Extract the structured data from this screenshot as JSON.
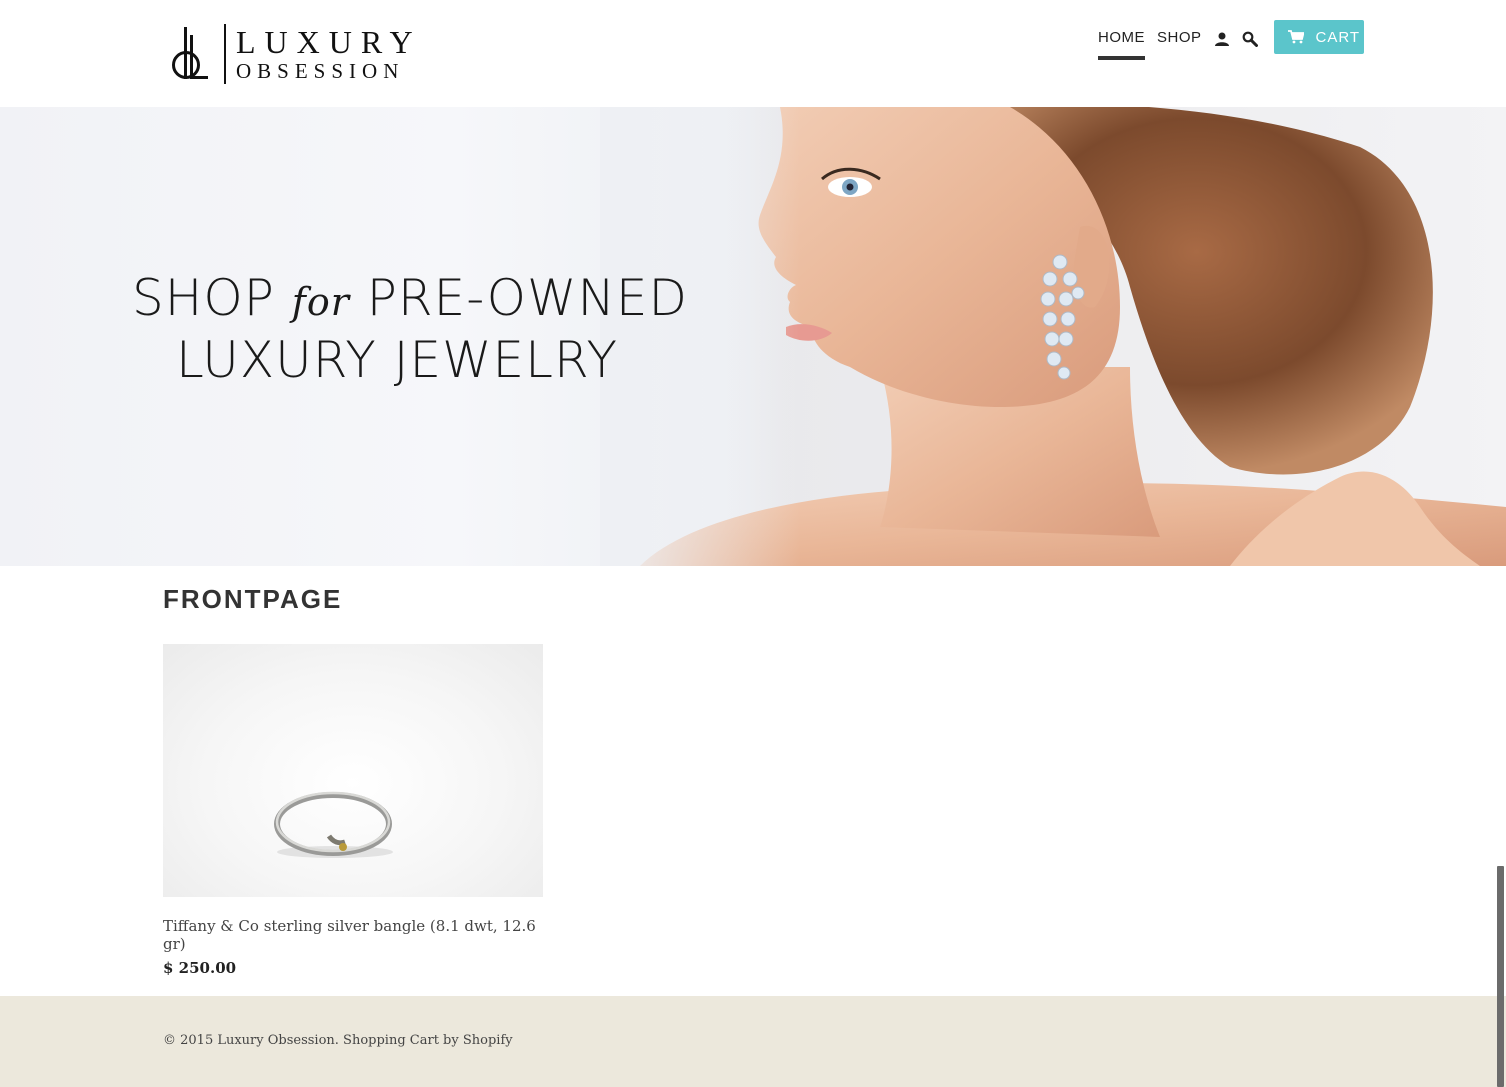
{
  "brand": {
    "name_line1": "LUXURY",
    "name_line2": "OBSESSION",
    "logo_monogram": "LO"
  },
  "nav": {
    "home_label": "HOME",
    "shop_label": "SHOP",
    "account_icon": "user-icon",
    "search_icon": "search-icon",
    "cart_label": "CART",
    "cart_icon": "cart-icon",
    "cart_color": "#5bc5cb"
  },
  "hero": {
    "line1_pre": "SHOP",
    "line1_for": "for",
    "line1_post": "PRE-OWNED",
    "line2": "LUXURY JEWELRY"
  },
  "main": {
    "section_title": "FRONTPAGE",
    "products": [
      {
        "name": "Tiffany & Co sterling silver bangle (8.1 dwt, 12.6 gr)",
        "price": "$ 250.00"
      }
    ]
  },
  "footer": {
    "copyright": "© 2015 Luxury Obsession. Shopping Cart by Shopify",
    "background": "#ece8dc"
  }
}
